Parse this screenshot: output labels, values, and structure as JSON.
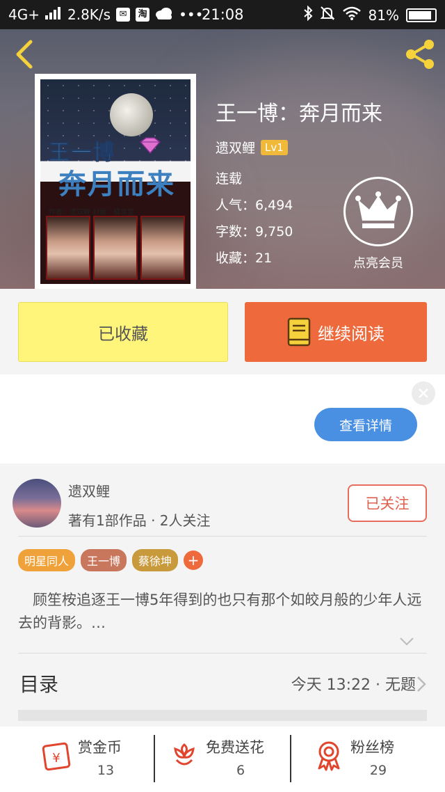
{
  "status_bar": {
    "network": "4G+",
    "speed": "2.8K/s",
    "app_badge": "淘",
    "more": "•••",
    "time": "21:08",
    "battery": "81%"
  },
  "book": {
    "title": "王一博：奔月而来",
    "author": "遗双鲤",
    "level": "Lv1",
    "status": "连载",
    "popularity": "人气：6,494",
    "word_count": "字数：9,750",
    "favorites": "收藏：21",
    "vip_label": "点亮会员",
    "cover": {
      "title_top": "王一博",
      "title_main": "奔月而来",
      "credits": "作者：遗双鲤  封面：橘宝宝",
      "badge": "DIAMOND"
    }
  },
  "actions": {
    "collected_label": "已收藏",
    "read_label": "继续阅读"
  },
  "ad": {
    "detail_label": "查看详情"
  },
  "author_card": {
    "name": "遗双鲤",
    "meta": "著有1部作品 · 2人关注",
    "follow_label": "已关注"
  },
  "tags": [
    {
      "label": "明星同人",
      "color": "#f0a23a"
    },
    {
      "label": "王一博",
      "color": "#c8775c"
    },
    {
      "label": "蔡徐坤",
      "color": "#c89a3c"
    }
  ],
  "tag_add_label": "+",
  "description": "　顾笙桉追逐王一博5年得到的也只有那个如皎月般的少年人远去的背影。…",
  "toc": {
    "label": "目录",
    "latest": "今天 13:22 · 无题"
  },
  "bottom_bar": [
    {
      "label": "赏金币",
      "count": "13",
      "icon": "reward-coin-icon"
    },
    {
      "label": "免费送花",
      "count": "6",
      "icon": "flower-icon"
    },
    {
      "label": "粉丝榜",
      "count": "29",
      "icon": "medal-icon"
    }
  ],
  "colors": {
    "accent_orange": "#ee6a3c",
    "collected_yellow": "#fff57a",
    "follow_red": "#e06050",
    "detail_blue": "#4a90e2",
    "level_gold": "#f0b93a"
  }
}
